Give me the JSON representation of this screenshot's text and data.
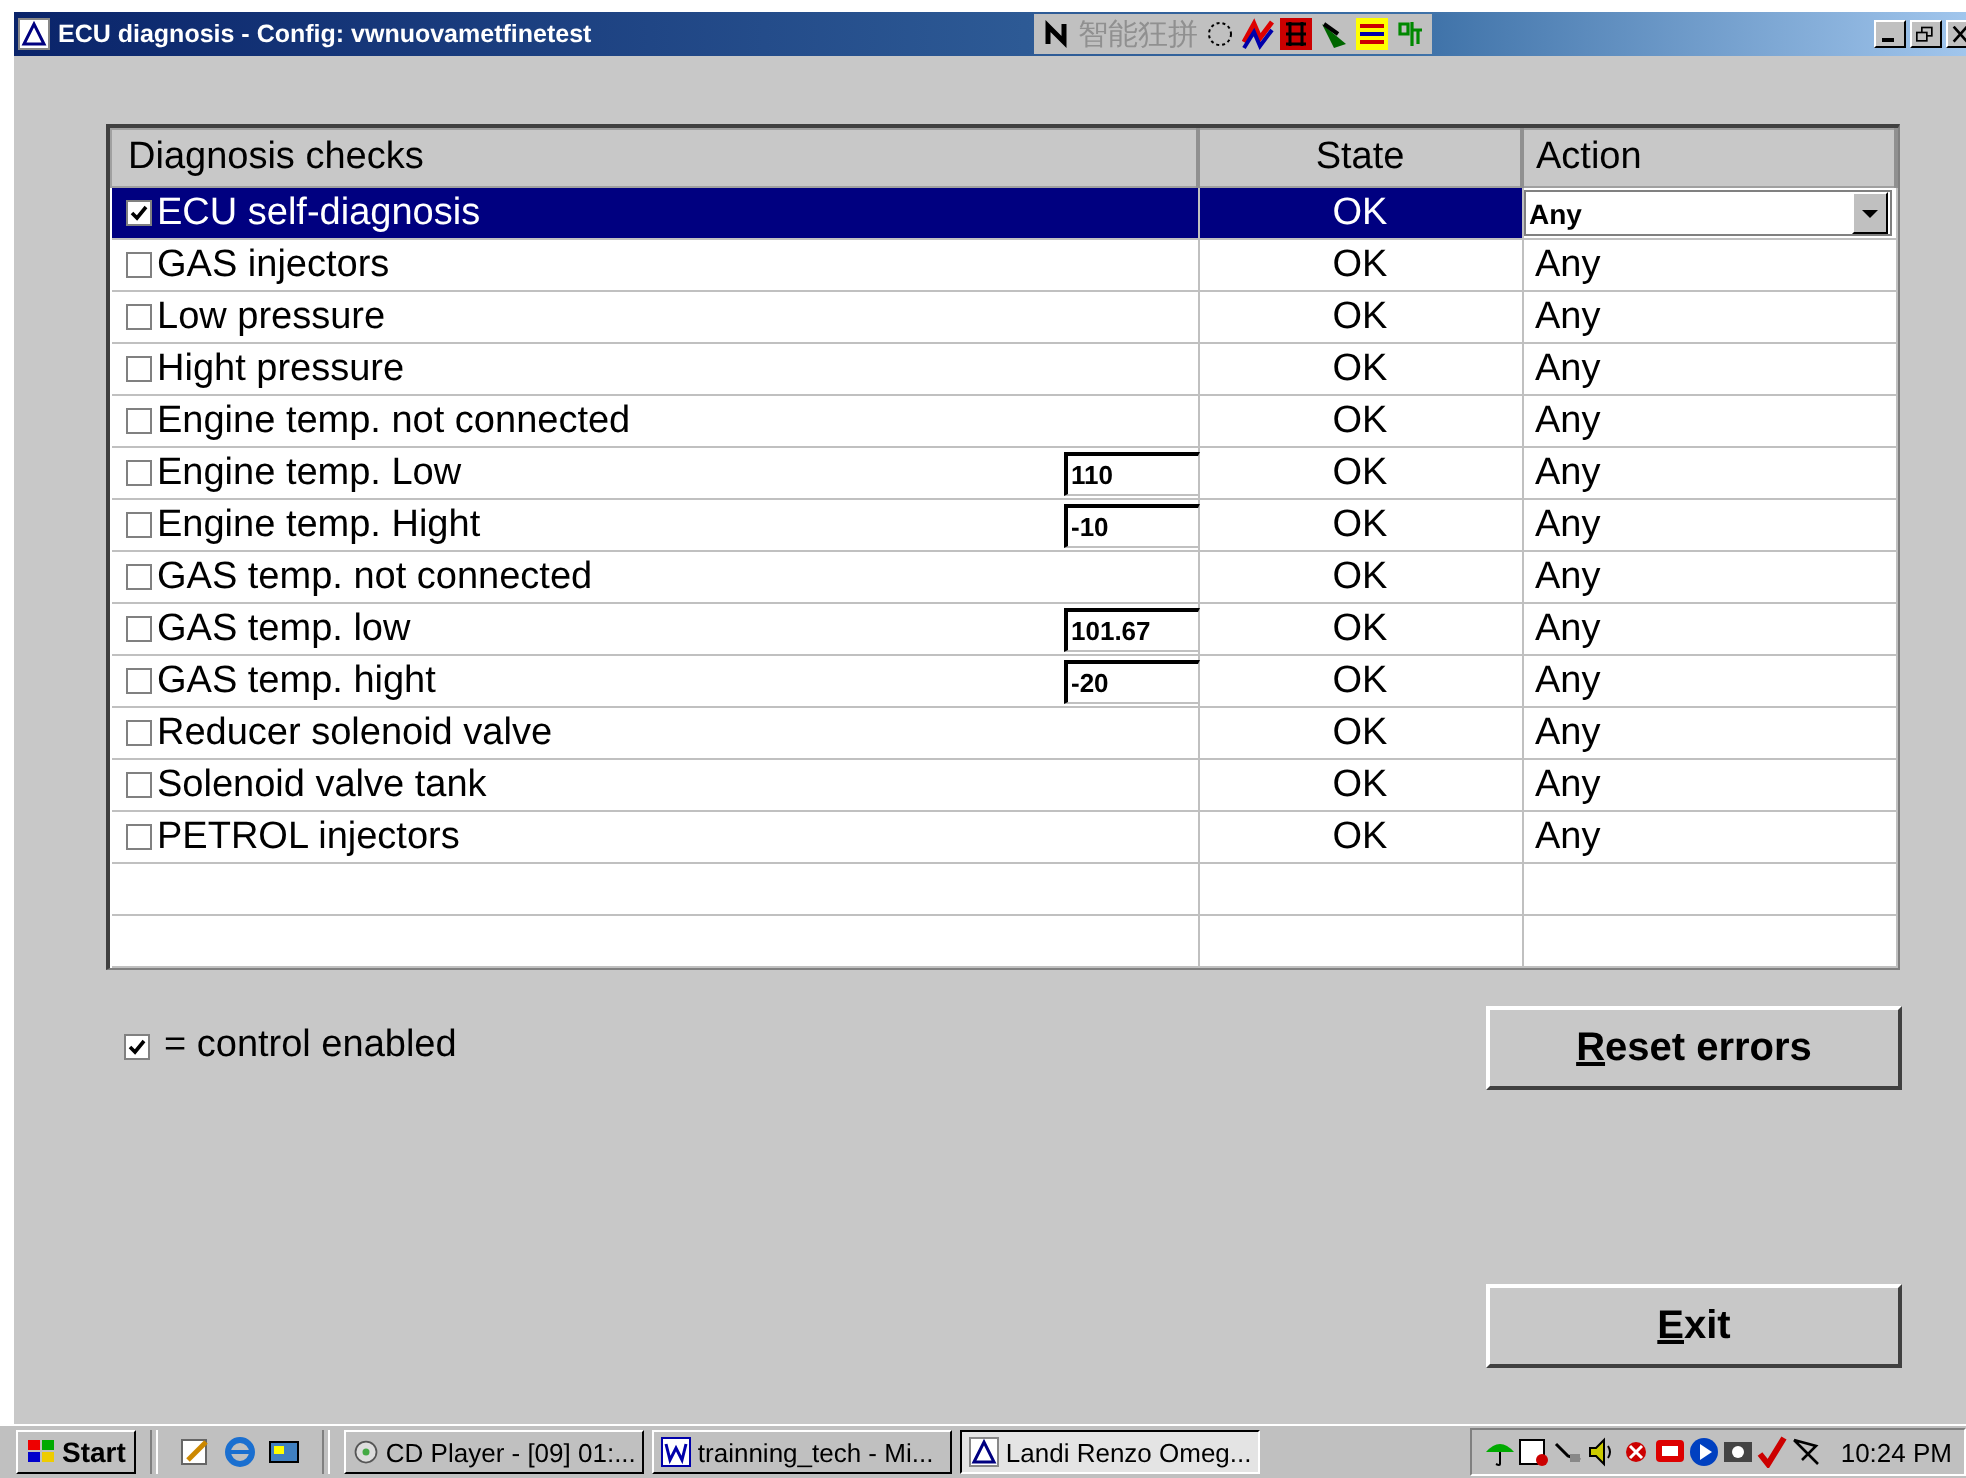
{
  "window": {
    "title": "ECU diagnosis - Config: vwnuovametfinetest",
    "ime_text": "智能狂拼"
  },
  "table": {
    "columns": [
      "Diagnosis checks",
      "State",
      "Action"
    ],
    "rows": [
      {
        "label": "ECU self-diagnosis",
        "checked": true,
        "selected": true,
        "state": "OK",
        "action": "Any"
      },
      {
        "label": "GAS injectors",
        "checked": false,
        "selected": false,
        "state": "OK",
        "action": "Any"
      },
      {
        "label": "Low pressure",
        "checked": false,
        "selected": false,
        "state": "OK",
        "action": "Any"
      },
      {
        "label": "Hight pressure",
        "checked": false,
        "selected": false,
        "state": "OK",
        "action": "Any"
      },
      {
        "label": "Engine temp. not connected",
        "checked": false,
        "selected": false,
        "state": "OK",
        "action": "Any"
      },
      {
        "label": "Engine temp. Low",
        "checked": false,
        "selected": false,
        "value": "110",
        "state": "OK",
        "action": "Any"
      },
      {
        "label": "Engine temp. Hight",
        "checked": false,
        "selected": false,
        "value": "-10",
        "state": "OK",
        "action": "Any"
      },
      {
        "label": "GAS temp. not connected",
        "checked": false,
        "selected": false,
        "state": "OK",
        "action": "Any"
      },
      {
        "label": "GAS temp. low",
        "checked": false,
        "selected": false,
        "value": "101.67",
        "state": "OK",
        "action": "Any"
      },
      {
        "label": "GAS temp. hight",
        "checked": false,
        "selected": false,
        "value": "-20",
        "state": "OK",
        "action": "Any"
      },
      {
        "label": "Reducer solenoid valve",
        "checked": false,
        "selected": false,
        "state": "OK",
        "action": "Any"
      },
      {
        "label": "Solenoid valve tank",
        "checked": false,
        "selected": false,
        "state": "OK",
        "action": "Any"
      },
      {
        "label": "PETROL injectors",
        "checked": false,
        "selected": false,
        "state": "OK",
        "action": "Any"
      }
    ]
  },
  "legend": {
    "checked": true,
    "text": "= control enabled"
  },
  "buttons": [
    {
      "label": "Reset errors",
      "mnemonic": true
    },
    {
      "label": "Exit",
      "mnemonic": true
    }
  ],
  "taskbar": {
    "start": "Start",
    "tasks": [
      {
        "label": "CD Player - [09] 01:...",
        "selected": false
      },
      {
        "label": "trainning_tech - Mi...",
        "selected": false
      },
      {
        "label": "Landi Renzo Omeg...",
        "selected": true
      }
    ],
    "clock": "10:24 PM"
  }
}
